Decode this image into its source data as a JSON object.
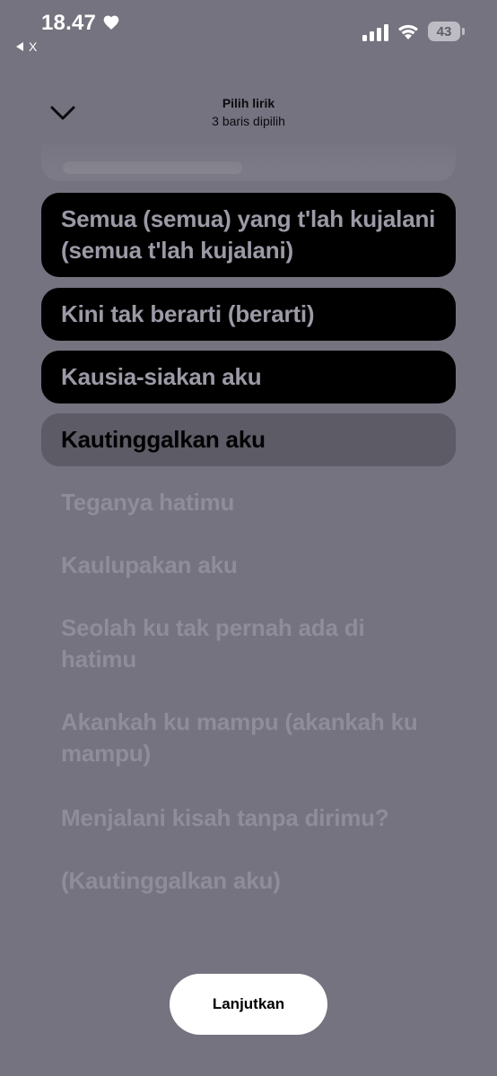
{
  "status_bar": {
    "time": "18.47",
    "back_app": "X",
    "battery": "43"
  },
  "header": {
    "title": "Pilih lirik",
    "subtitle": "3 baris dipilih"
  },
  "lyrics": [
    {
      "text": "Semua (semua) yang t'lah kujalani (semua t'lah kujalani)",
      "state": "selected"
    },
    {
      "text": "Kini tak berarti (berarti)",
      "state": "selected"
    },
    {
      "text": "Kausia-siakan aku",
      "state": "selected"
    },
    {
      "text": "Kautinggalkan aku",
      "state": "anchor"
    },
    {
      "text": "Teganya hatimu",
      "state": "unselected"
    },
    {
      "text": "Kaulupakan aku",
      "state": "unselected"
    },
    {
      "text": "Seolah ku tak pernah ada di hatimu",
      "state": "unselected"
    },
    {
      "text": "Akankah ku mampu (akankah ku mampu)",
      "state": "unselected"
    },
    {
      "text": "Menjalani kisah tanpa dirimu?",
      "state": "unselected"
    },
    {
      "text": "(Kautinggalkan aku)",
      "state": "unselected"
    }
  ],
  "continue_label": "Lanjutkan"
}
